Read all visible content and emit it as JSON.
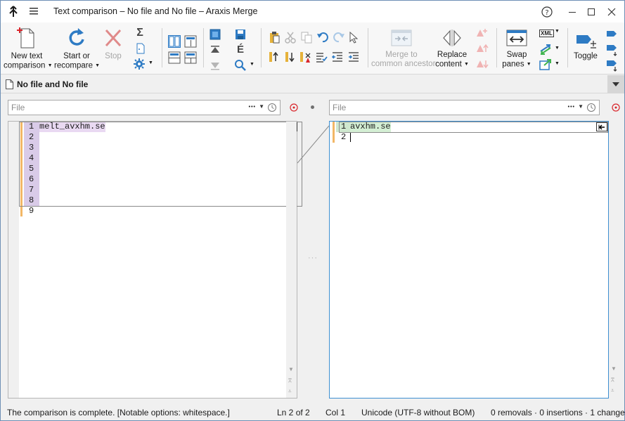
{
  "window": {
    "title": "Text comparison – No file and No file – Araxis Merge"
  },
  "ribbon": {
    "new_text_comparison": "New text",
    "new_text_comparison2": "comparison",
    "start_or_recompare": "Start or",
    "start_or_recompare2": "recompare",
    "stop": "Stop",
    "merge_to_common_ancestor": "Merge to",
    "merge_to_common_ancestor2": "common ancestor",
    "replace_content": "Replace",
    "replace_content2": "content",
    "swap_panes": "Swap",
    "swap_panes2": "panes",
    "toggle": "Toggle",
    "xml_badge": "XML",
    "sigma": "Σ",
    "e_accent": "É"
  },
  "document": {
    "tab_title": "No file and No file"
  },
  "left": {
    "file_placeholder": "File",
    "ellipsis": "•••",
    "lines": [
      {
        "n": "1",
        "t": "melt_avxhm.se"
      },
      {
        "n": "2",
        "t": ""
      },
      {
        "n": "3",
        "t": ""
      },
      {
        "n": "4",
        "t": ""
      },
      {
        "n": "5",
        "t": ""
      },
      {
        "n": "6",
        "t": ""
      },
      {
        "n": "7",
        "t": ""
      },
      {
        "n": "8",
        "t": ""
      },
      {
        "n": "9",
        "t": ""
      }
    ]
  },
  "right": {
    "file_placeholder": "File",
    "ellipsis": "•••",
    "lines": [
      {
        "n": "1",
        "t": "avxhm.se"
      },
      {
        "n": "2",
        "t": ""
      }
    ]
  },
  "middle": {
    "ellipsis": "···"
  },
  "status": {
    "message": "The comparison is complete. [Notable options: whitespace.]",
    "line": "Ln 2 of 2",
    "col": "Col 1",
    "encoding": "Unicode (UTF-8 without BOM)",
    "summary": "0 removals · 0 insertions · 1 change"
  },
  "colors": {
    "accent_blue": "#2e7bc4",
    "stop_red": "#e08a8a",
    "change_purple": "#e9d9f2",
    "match_green": "#d4efd4",
    "line_marker": "#f2b766"
  }
}
